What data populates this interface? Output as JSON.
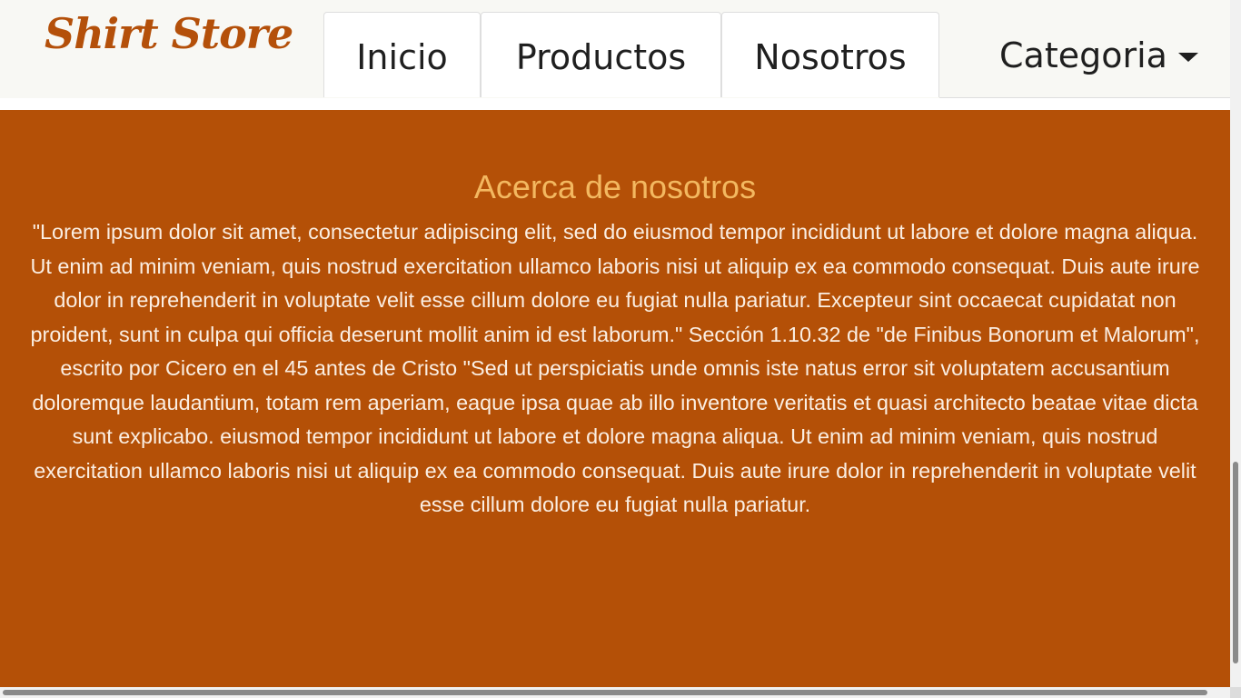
{
  "navbar": {
    "brand": "Shirt Store",
    "tabs": [
      {
        "label": "Inicio"
      },
      {
        "label": "Productos"
      },
      {
        "label": "Nosotros"
      }
    ],
    "dropdown_label": "Categoria",
    "dropdown_icon": "caret-down-icon"
  },
  "about": {
    "title": "Acerca de nosotros",
    "body": "\"Lorem ipsum dolor sit amet, consectetur adipiscing elit, sed do eiusmod tempor incididunt ut labore et dolore magna aliqua. Ut enim ad minim veniam, quis nostrud exercitation ullamco laboris nisi ut aliquip ex ea commodo consequat. Duis aute irure dolor in reprehenderit in voluptate velit esse cillum dolore eu fugiat nulla pariatur. Excepteur sint occaecat cupidatat non proident, sunt in culpa qui officia deserunt mollit anim id est laborum.\" Sección 1.10.32 de \"de Finibus Bonorum et Malorum\", escrito por Cicero en el 45 antes de Cristo \"Sed ut perspiciatis unde omnis iste natus error sit voluptatem accusantium doloremque laudantium, totam rem aperiam, eaque ipsa quae ab illo inventore veritatis et quasi architecto beatae vitae dicta sunt explicabo. eiusmod tempor incididunt ut labore et dolore magna aliqua. Ut enim ad minim veniam, quis nostrud exercitation ullamco laboris nisi ut aliquip ex ea commodo consequat. Duis aute irure dolor in reprehenderit in voluptate velit esse cillum dolore eu fugiat nulla pariatur."
  },
  "colors": {
    "brand": "#b4500a",
    "section_background": "#b45007",
    "section_title": "#f3b860",
    "section_text": "#fbeee2",
    "navbar_background": "#f8f8f4"
  }
}
